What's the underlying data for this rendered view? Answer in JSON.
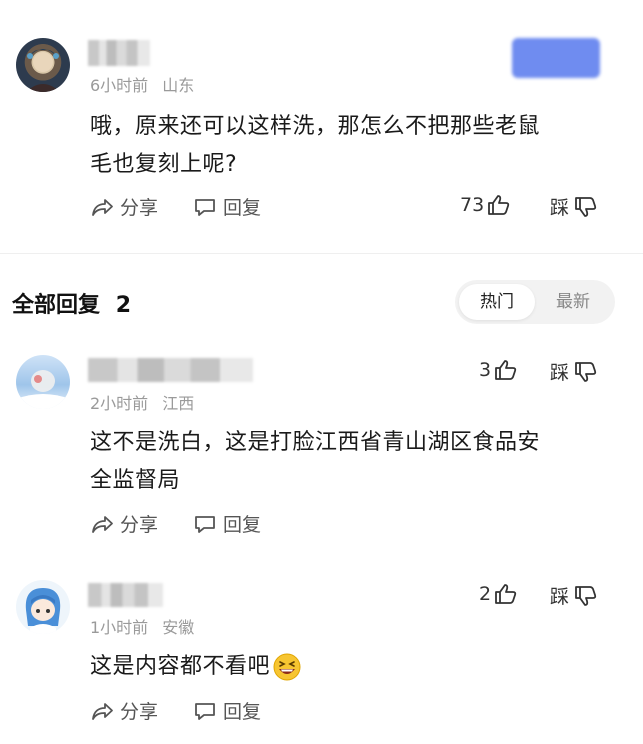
{
  "top_comment": {
    "time": "6小时前",
    "location": "山东",
    "text_line1": "哦，原来还可以这样洗，那怎么不把那些老鼠",
    "text_line2": "毛也复刻上呢?",
    "share_label": "分享",
    "reply_label": "回复",
    "like_count": "73",
    "dislike_label": "踩"
  },
  "replies_header": {
    "title": "全部回复",
    "count": "2",
    "tabs": [
      {
        "label": "热门",
        "active": true
      },
      {
        "label": "最新",
        "active": false
      }
    ]
  },
  "replies": [
    {
      "time": "2小时前",
      "location": "江西",
      "text_line1": "这不是洗白，这是打脸江西省青山湖区食品安",
      "text_line2": "全监督局",
      "like_count": "3",
      "dislike_label": "踩",
      "share_label": "分享",
      "reply_label": "回复"
    },
    {
      "time": "1小时前",
      "location": "安徽",
      "text_line1": "这是内容都不看吧",
      "like_count": "2",
      "dislike_label": "踩",
      "share_label": "分享",
      "reply_label": "回复"
    }
  ],
  "colors": {
    "text": "#1a1a1a",
    "meta": "#9a9a9a",
    "blurred_badge": "#6f8cf0"
  },
  "icons": [
    "share-icon",
    "comment-icon",
    "thumbs-up-icon",
    "thumbs-down-icon",
    "grinning-emoji-icon"
  ]
}
